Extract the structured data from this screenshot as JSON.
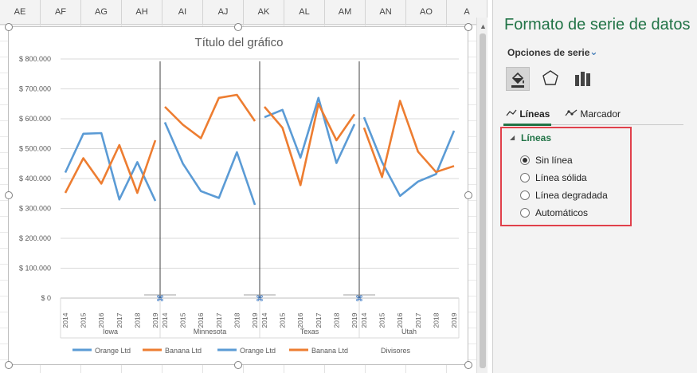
{
  "spreadsheet": {
    "columns": [
      "AE",
      "AF",
      "AG",
      "AH",
      "AI",
      "AJ",
      "AK",
      "AL",
      "AM",
      "AN",
      "AO",
      "A"
    ]
  },
  "panel": {
    "title": "Formato de serie de datos",
    "options_label": "Opciones de serie",
    "icons": [
      "fill-line-icon",
      "effects-pentagon-icon",
      "series-options-bar-icon"
    ],
    "tabs": {
      "lines": "Líneas",
      "marker": "Marcador"
    },
    "section": "Líneas",
    "radio_options": [
      {
        "label": "Sin línea",
        "selected": true
      },
      {
        "label": "Línea sólida",
        "selected": false
      },
      {
        "label": "Línea degradada",
        "selected": false
      },
      {
        "label": "Automáticos",
        "selected": false
      }
    ]
  },
  "chart_data": {
    "type": "line",
    "title": "Título del gráfico",
    "xlabel": "",
    "ylabel": "",
    "ylim": [
      0,
      800000
    ],
    "yticks": [
      "$ 0",
      "$ 100.000",
      "$ 200.000",
      "$ 300.000",
      "$ 400.000",
      "$ 500.000",
      "$ 600.000",
      "$ 700.000",
      "$ 800.000"
    ],
    "groups": [
      "Iowa",
      "Minnesota",
      "Texas",
      "Utah"
    ],
    "years": [
      "2014",
      "2015",
      "2016",
      "2017",
      "2018",
      "2019"
    ],
    "series": [
      {
        "name": "Orange Ltd",
        "color": "#5b9bd5",
        "values": [
          [
            420000,
            550000,
            552000,
            330000,
            455000,
            325000
          ],
          [
            588000,
            450000,
            358000,
            335000,
            488000,
            312000
          ],
          [
            605000,
            630000,
            470000,
            670000,
            452000,
            582000
          ],
          [
            605000,
            455000,
            342000,
            390000,
            415000,
            560000
          ]
        ]
      },
      {
        "name": "Banana Ltd",
        "color": "#ed7d31",
        "values": [
          [
            352000,
            468000,
            383000,
            512000,
            352000,
            528000
          ],
          [
            640000,
            580000,
            535000,
            670000,
            680000,
            592000
          ],
          [
            640000,
            570000,
            378000,
            650000,
            528000,
            615000
          ],
          [
            570000,
            405000,
            660000,
            490000,
            422000,
            442000
          ]
        ]
      }
    ],
    "legend": [
      {
        "name": "Orange Ltd",
        "color": "#5b9bd5"
      },
      {
        "name": "Banana Ltd",
        "color": "#ed7d31"
      },
      {
        "name": "Orange Ltd",
        "color": "#5b9bd5"
      },
      {
        "name": "Banana Ltd",
        "color": "#ed7d31"
      },
      {
        "name": "Divisores",
        "color": ""
      }
    ],
    "legend_position": "bottom",
    "gridlines": true
  }
}
